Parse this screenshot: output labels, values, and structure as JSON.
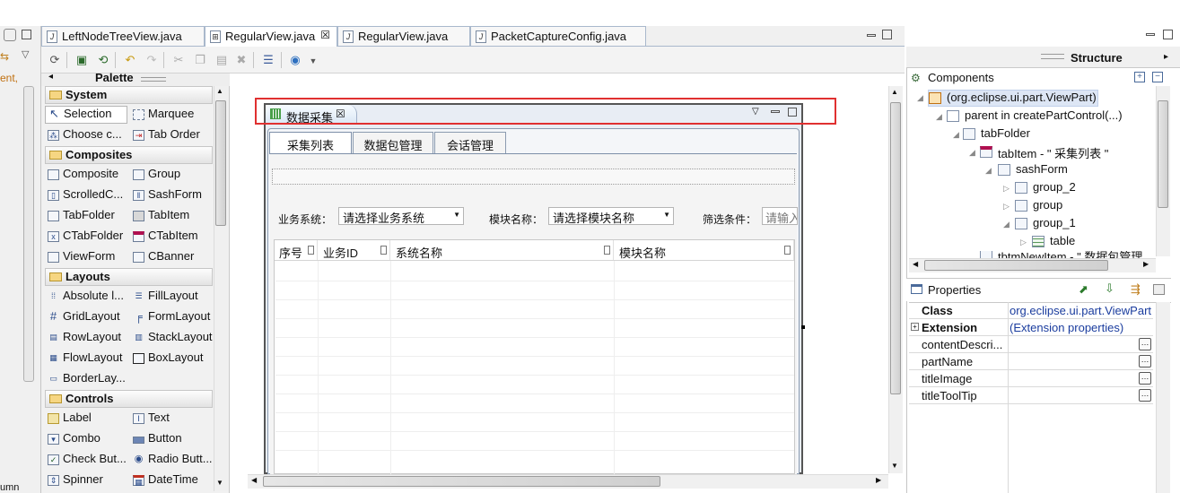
{
  "editor_tabs": [
    {
      "label": "LeftNodeTreeView.java",
      "active": false
    },
    {
      "label": "RegularView.java",
      "active": true,
      "closable": true
    },
    {
      "label": "RegularView.java",
      "active": false
    },
    {
      "label": "PacketCaptureConfig.java",
      "active": false
    }
  ],
  "left_stub": {
    "text_top": "ent,",
    "text_bottom": "umn"
  },
  "toolbar_icons": [
    "run-icon",
    "preview-icon",
    "refresh-icon",
    "undo-icon",
    "redo-icon",
    "cut-icon",
    "copy-icon",
    "paste-icon",
    "delete-icon",
    "layout-icon",
    "globe-icon",
    "dropdown-icon"
  ],
  "palette": {
    "title": "Palette",
    "groups": [
      {
        "label": "System",
        "items": [
          "Selection",
          "Marquee",
          "Choose c...",
          "Tab Order"
        ]
      },
      {
        "label": "Composites",
        "items": [
          "Composite",
          "Group",
          "ScrolledC...",
          "SashForm",
          "TabFolder",
          "TabItem",
          "CTabFolder",
          "CTabItem",
          "ViewForm",
          "CBanner"
        ]
      },
      {
        "label": "Layouts",
        "items": [
          "Absolute l...",
          "FillLayout",
          "GridLayout",
          "FormLayout",
          "RowLayout",
          "StackLayout",
          "FlowLayout",
          "BoxLayout",
          "BorderLay..."
        ]
      },
      {
        "label": "Controls",
        "items": [
          "Label",
          "Text",
          "Combo",
          "Button",
          "Check But...",
          "Radio Butt...",
          "Spinner",
          "DateTime"
        ]
      }
    ]
  },
  "design": {
    "view_tab_title": "数据采集",
    "inner_tabs": [
      "采集列表",
      "数据包管理",
      "会话管理"
    ],
    "filters": {
      "business_label": "业务系统：",
      "business_value": "请选择业务系统",
      "module_label": "模块名称：",
      "module_value": "请选择模块名称",
      "filter_label": "筛选条件：",
      "filter_placeholder": "请输入"
    },
    "columns": [
      "序号",
      "业务ID",
      "系统名称",
      "模块名称"
    ]
  },
  "structure": {
    "title": "Structure",
    "components_label": "Components",
    "tree": [
      "(org.eclipse.ui.part.ViewPart)",
      "parent in createPartControl(...)",
      "tabFolder",
      "tabItem - \"   采集列表   \"",
      "sashForm",
      "group_2",
      "group",
      "group_1",
      "table",
      "tbtmNewItem - \"   数据包管理"
    ]
  },
  "properties": {
    "title": "Properties",
    "rows": [
      {
        "key": "Class",
        "value": "org.eclipse.ui.part.ViewPart",
        "bold": true,
        "button": false
      },
      {
        "key": "Extension",
        "value": "(Extension properties)",
        "bold": true,
        "button": false
      },
      {
        "key": "contentDescri...",
        "value": "",
        "bold": false,
        "button": true
      },
      {
        "key": "partName",
        "value": "",
        "bold": false,
        "button": true
      },
      {
        "key": "titleImage",
        "value": "",
        "bold": false,
        "button": true
      },
      {
        "key": "titleToolTip",
        "value": "",
        "bold": false,
        "button": true
      }
    ]
  },
  "colors": {
    "highlight_box": "#e03030",
    "selection_row": "#dde6f5",
    "tab_border": "#a9b8cc"
  }
}
